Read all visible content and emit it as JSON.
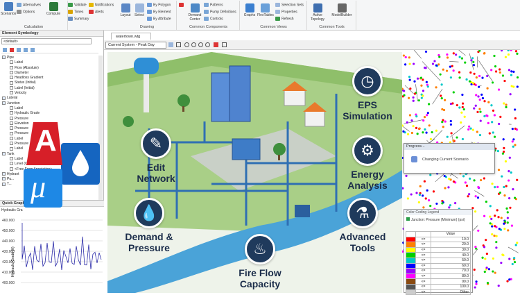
{
  "ribbon": {
    "groups": [
      {
        "label": "Calculation"
      },
      {
        "label": "Drawing"
      },
      {
        "label": "Common Components"
      },
      {
        "label": "Common Views"
      },
      {
        "label": "Common Tools"
      }
    ],
    "items": {
      "scenarios": "Scenarios",
      "alternatives": "Alternatives",
      "options": "Options",
      "compute": "Compute",
      "validate": "Validate",
      "times": "Times",
      "summary": "Summary",
      "notifications": "Notifications",
      "alerts": "Alerts",
      "layout": "Layout",
      "select": "Select",
      "by_polygon": "By Polygon",
      "by_element": "By Element",
      "by_attribute": "By Attribute",
      "demand_center": "Demand Center",
      "patterns": "Patterns",
      "pump_definitions": "Pump Definitions",
      "controls": "Controls",
      "graphs": "Graphs",
      "flextables": "FlexTables",
      "selection_sets": "Selection Sets",
      "properties": "Properties",
      "refresh": "Refresh",
      "active_topology": "Active Topology",
      "modelbuilder": "ModelBuilder"
    }
  },
  "sidebar": {
    "title": "Element Symbology",
    "dropdown": "<default>",
    "tree": [
      {
        "label": "Pipe",
        "checked": true,
        "indent": 1
      },
      {
        "label": "Label",
        "checked": false,
        "indent": 2
      },
      {
        "label": "Flow (Absolute)",
        "checked": false,
        "indent": 2
      },
      {
        "label": "Diameter",
        "checked": false,
        "indent": 2
      },
      {
        "label": "Headloss Gradient",
        "checked": false,
        "indent": 2
      },
      {
        "label": "Status (Initial)",
        "checked": false,
        "indent": 2
      },
      {
        "label": "Label (Initial)",
        "checked": false,
        "indent": 2
      },
      {
        "label": "Velocity",
        "checked": false,
        "indent": 2
      },
      {
        "label": "Lateral",
        "checked": true,
        "indent": 1
      },
      {
        "label": "Junction",
        "checked": true,
        "indent": 1
      },
      {
        "label": "Label",
        "checked": false,
        "indent": 2
      },
      {
        "label": "Hydraulic Grade",
        "checked": false,
        "indent": 2
      },
      {
        "label": "Pressure",
        "checked": false,
        "indent": 2
      },
      {
        "label": "Elevation",
        "checked": false,
        "indent": 2
      },
      {
        "label": "Pressure",
        "checked": false,
        "indent": 2
      },
      {
        "label": "Pressure",
        "checked": false,
        "indent": 2
      },
      {
        "label": "Label",
        "checked": false,
        "indent": 2
      },
      {
        "label": "Pressure",
        "checked": false,
        "indent": 2
      },
      {
        "label": "Label",
        "checked": false,
        "indent": 2
      },
      {
        "label": "Tank",
        "checked": true,
        "indent": 1
      },
      {
        "label": "Label",
        "checked": false,
        "indent": 2
      },
      {
        "label": "Level (Calculated)",
        "checked": false,
        "indent": 2
      },
      {
        "label": "<Free Form Annotation>",
        "checked": false,
        "indent": 2
      },
      {
        "label": "Hydrant",
        "checked": true,
        "indent": 1
      },
      {
        "label": "Pu...",
        "checked": true,
        "indent": 1
      },
      {
        "label": "T...",
        "checked": true,
        "indent": 1
      }
    ],
    "quick_graph_title": "Quick Graph",
    "graph_series_label": "Hydraulic Gra",
    "graph_ylabel": "Hydraulic Grade (ft)",
    "graph_yticks": [
      "460.000",
      "450.000",
      "440.000",
      "430.000",
      "420.000",
      "410.000",
      "400.000"
    ]
  },
  "document": {
    "tab": "watertown.wtg",
    "scenario": "Current System - Peak Day"
  },
  "progress": {
    "title": "Progress...",
    "message": "Changing Current Scenario"
  },
  "legend": {
    "title": "Color Coding Legend",
    "heading": "Junction: Pressure (Minimum) (psi)",
    "col_value": "Value",
    "rows": [
      {
        "op": "<=",
        "value": "10.0",
        "color": "#ff0000"
      },
      {
        "op": "<=",
        "value": "20.0",
        "color": "#ff7f00"
      },
      {
        "op": "<=",
        "value": "30.0",
        "color": "#ffff00"
      },
      {
        "op": "<=",
        "value": "40.0",
        "color": "#00d000"
      },
      {
        "op": "<=",
        "value": "50.0",
        "color": "#00c8c8"
      },
      {
        "op": "<=",
        "value": "60.0",
        "color": "#0000ff"
      },
      {
        "op": "<=",
        "value": "70.0",
        "color": "#9a00ff"
      },
      {
        "op": "<=",
        "value": "80.0",
        "color": "#ff00ff"
      },
      {
        "op": "<=",
        "value": "90.0",
        "color": "#8a4a10"
      },
      {
        "op": "<=",
        "value": "100.0",
        "color": "#555555"
      },
      {
        "op": "<=",
        "value": "Other",
        "color": "#cccccc"
      }
    ]
  },
  "promo": {
    "features": [
      {
        "key": "edit",
        "line1": "Edit",
        "line2": "Network"
      },
      {
        "key": "eps",
        "line1": "EPS",
        "line2": "Simulation"
      },
      {
        "key": "energy",
        "line1": "Energy",
        "line2": "Analysis"
      },
      {
        "key": "demand",
        "line1": "Demand &",
        "line2": "Pressure"
      },
      {
        "key": "tools",
        "line1": "Advanced",
        "line2": "Tools"
      },
      {
        "key": "fire",
        "line1": "Fire Flow",
        "line2": "Capacity"
      }
    ],
    "colors": {
      "navy": "#1f3a5c",
      "water": "#4aa3d8",
      "grass": "#a9cf87",
      "road": "#c9d0c7"
    }
  },
  "logos": {
    "autocad_letter": "A",
    "mu_letter": "μ",
    "autocad_color": "#d71f28",
    "mu_color": "#1565c0"
  }
}
